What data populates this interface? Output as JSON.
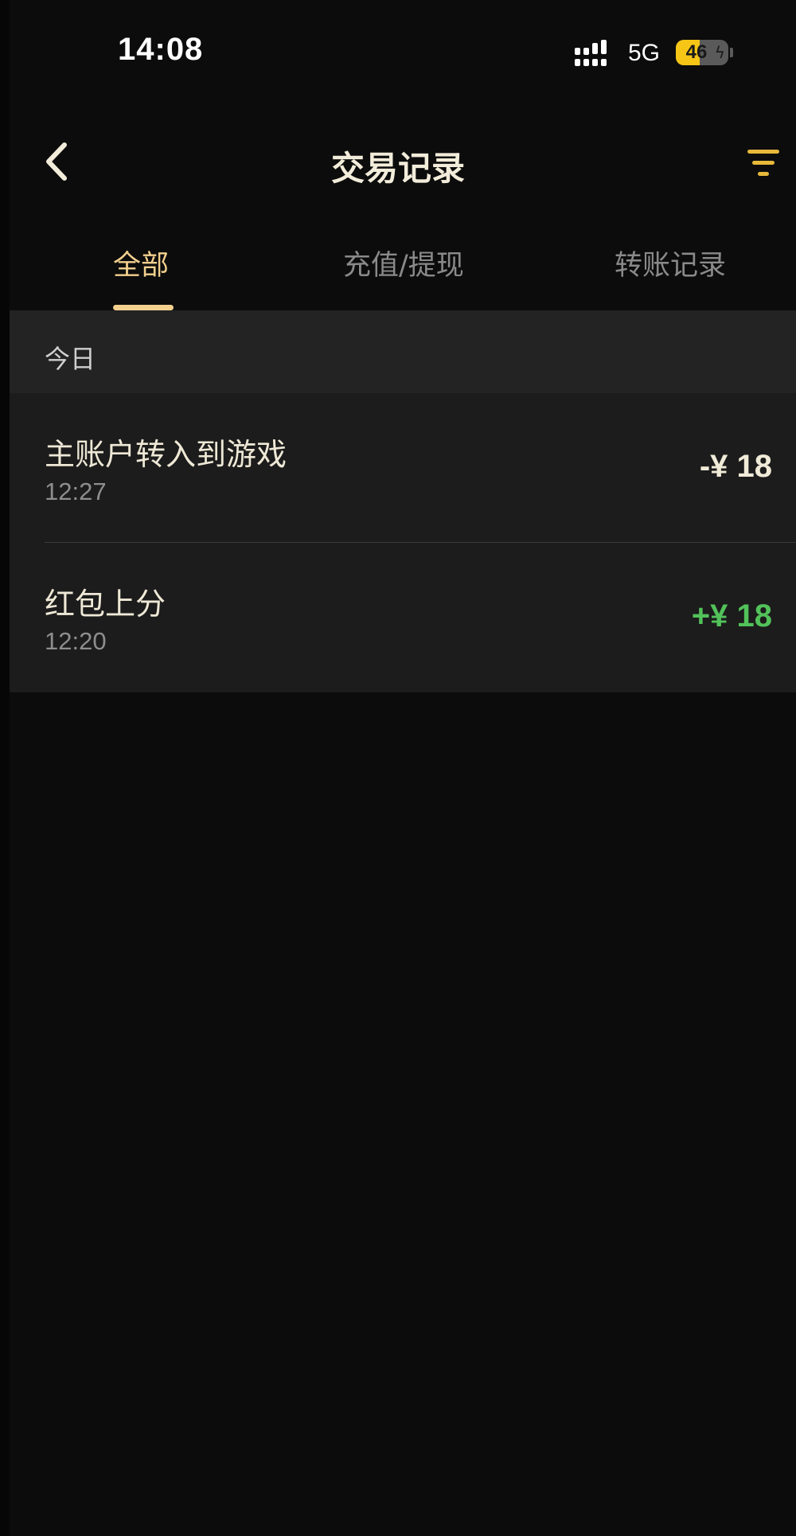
{
  "status_bar": {
    "time": "14:08",
    "network": "5G",
    "battery": {
      "text": "46",
      "level": 0.46
    }
  },
  "nav": {
    "title": "交易记录",
    "back_icon": "chevron-left-icon",
    "filter_icon": "filter-icon"
  },
  "tabs": [
    {
      "label": "全部",
      "active": true
    },
    {
      "label": "充值/提现",
      "active": false
    },
    {
      "label": "转账记录",
      "active": false
    }
  ],
  "colors": {
    "accent": "#f3d08e",
    "filter_icon": "#e8b93a",
    "amount_negative": "#f0ead8",
    "amount_positive": "#52c25a",
    "background": "#0c0c0c"
  },
  "section": {
    "date_label": "今日"
  },
  "transactions": [
    {
      "title": "主账户转入到游戏",
      "time": "12:27",
      "amount": "-¥ 18"
    },
    {
      "title": "红包上分",
      "time": "12:20",
      "amount": "+¥ 18"
    }
  ]
}
